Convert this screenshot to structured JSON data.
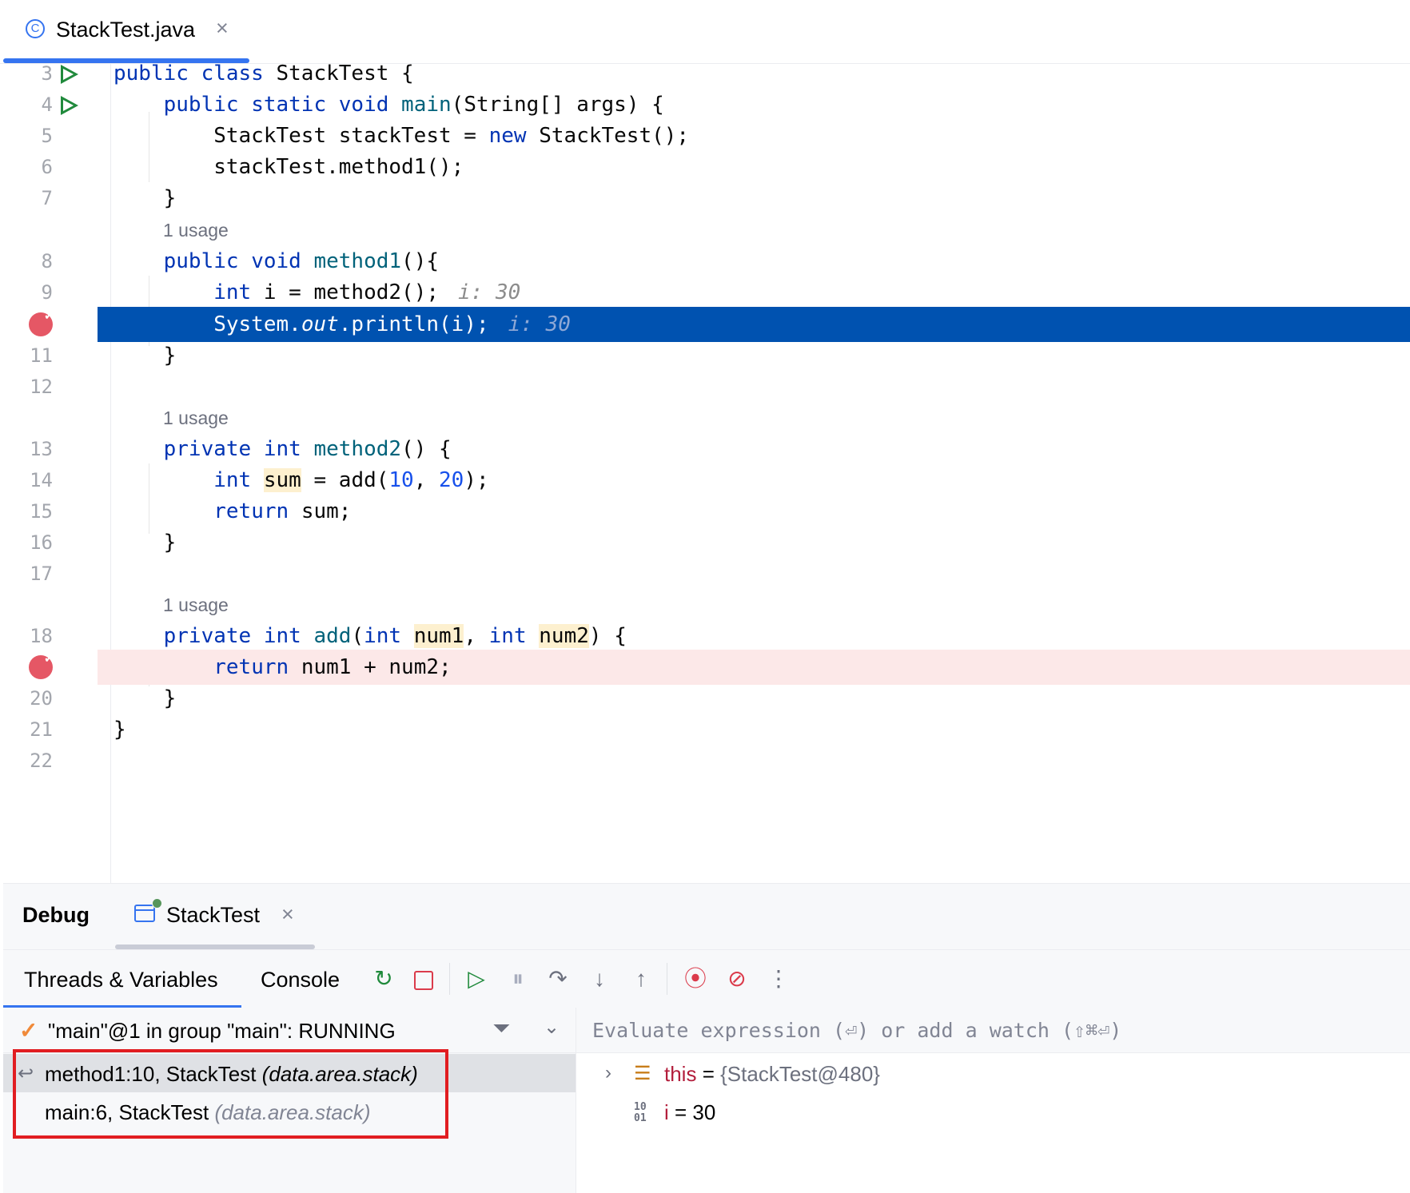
{
  "editor_tab": {
    "icon": "C",
    "filename": "StackTest.java",
    "close": "×"
  },
  "code_lines": [
    {
      "num": "3",
      "code": "public class StackTest {"
    },
    {
      "num": "4",
      "code": "    public static void main(String[] args) {"
    },
    {
      "num": "5",
      "code": "        StackTest stackTest = new StackTest();"
    },
    {
      "num": "6",
      "code": "        stackTest.method1();"
    },
    {
      "num": "7",
      "code": "    }"
    },
    {
      "num": "8",
      "code": "    public void method1(){"
    },
    {
      "num": "9",
      "code": "        int i = method2();",
      "hint": "i: 30"
    },
    {
      "num": "10",
      "code": "        System.out.println(i);",
      "hint": "i: 30",
      "current": true
    },
    {
      "num": "11",
      "code": "    }"
    },
    {
      "num": "12",
      "code": ""
    },
    {
      "num": "13",
      "code": "    private int method2() {"
    },
    {
      "num": "14",
      "code": "        int sum = add(10, 20);"
    },
    {
      "num": "15",
      "code": "        return sum;"
    },
    {
      "num": "16",
      "code": "    }"
    },
    {
      "num": "17",
      "code": ""
    },
    {
      "num": "18",
      "code": "    private int add(int num1, int num2) {"
    },
    {
      "num": "19",
      "code": "        return num1 + num2;",
      "breakpoint": true
    },
    {
      "num": "20",
      "code": "    }"
    },
    {
      "num": "21",
      "code": "}"
    },
    {
      "num": "22",
      "code": ""
    }
  ],
  "usage_label": "1 usage",
  "hint_line9": "i: 30",
  "hint_line10": "i: 30",
  "debug": {
    "title": "Debug",
    "session_tab": "StackTest",
    "session_close": "×",
    "tabs": {
      "threads_variables": "Threads & Variables",
      "console": "Console"
    },
    "thread_status": "\"main\"@1 in group \"main\": RUNNING",
    "frames": [
      {
        "method": "method1:10, StackTest",
        "package": "(data.area.stack)",
        "selected": true
      },
      {
        "method": "main:6, StackTest",
        "package": "(data.area.stack)",
        "selected": false
      }
    ],
    "evaluate_placeholder": "Evaluate expression (⏎) or add a watch (⇧⌘⏎)",
    "variables": [
      {
        "name": "this",
        "eq": " = ",
        "value": "{StackTest@480}"
      },
      {
        "name": "i",
        "eq": " = ",
        "value": "30"
      }
    ]
  },
  "colors": {
    "accent": "#3574f0",
    "current_line": "#0052b0",
    "breakpoint": "#e55765",
    "breakpoint_line": "#fce8e8",
    "highlight_box": "#e11d21"
  }
}
